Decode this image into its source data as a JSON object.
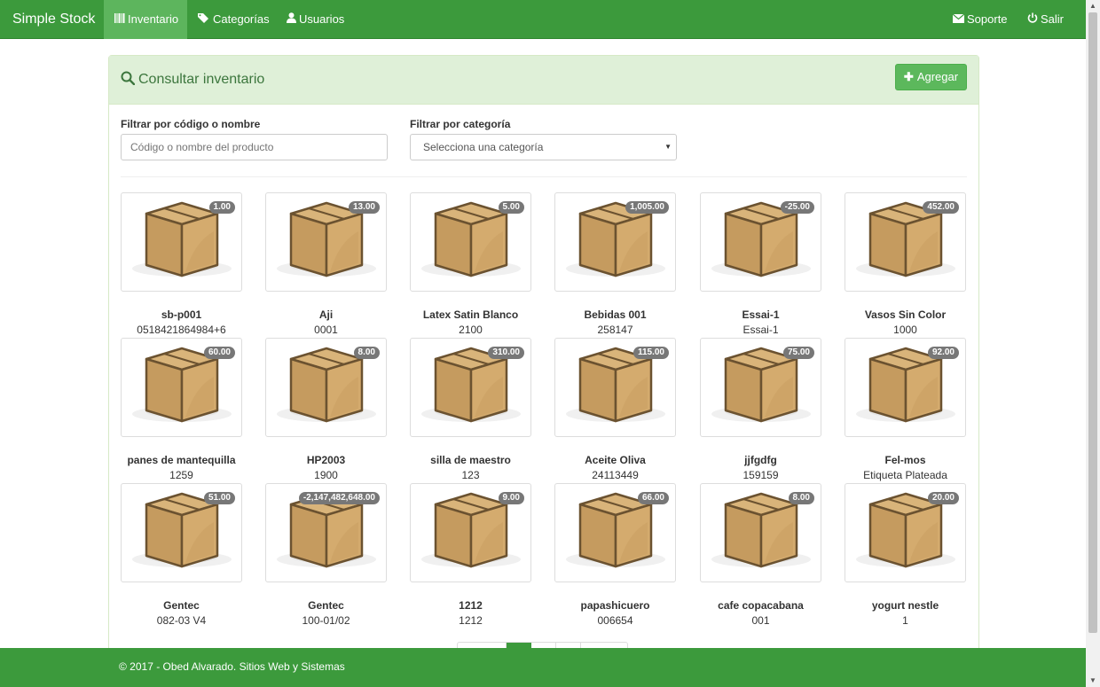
{
  "navbar": {
    "brand": "Simple Stock",
    "items": [
      {
        "label": "Inventario",
        "icon": "barcode-icon"
      },
      {
        "label": "Categorías",
        "icon": "tags-icon"
      },
      {
        "label": "Usuarios",
        "icon": "user-icon"
      }
    ],
    "right_items": [
      {
        "label": "Soporte",
        "icon": "envelope-icon"
      },
      {
        "label": "Salir",
        "icon": "power-icon"
      }
    ]
  },
  "panel": {
    "title": "Consultar inventario",
    "add_button": "Agregar",
    "filter_code_label": "Filtrar por código o nombre",
    "filter_code_placeholder": "Código o nombre del producto",
    "filter_category_label": "Filtrar por categoría",
    "filter_category_selected": "Selecciona una categoría"
  },
  "products": [
    {
      "name": "sb-p001",
      "code": "0518421864984+6",
      "stock": "1.00"
    },
    {
      "name": "Aji",
      "code": "0001",
      "stock": "13.00"
    },
    {
      "name": "Latex Satin Blanco",
      "code": "2100",
      "stock": "5.00"
    },
    {
      "name": "Bebidas 001",
      "code": "258147",
      "stock": "1,005.00"
    },
    {
      "name": "Essai-1",
      "code": "Essai-1",
      "stock": "-25.00"
    },
    {
      "name": "Vasos Sin Color",
      "code": "1000",
      "stock": "452.00"
    },
    {
      "name": "panes de mantequilla",
      "code": "1259",
      "stock": "60.00"
    },
    {
      "name": "HP2003",
      "code": "1900",
      "stock": "8.00"
    },
    {
      "name": "silla de maestro",
      "code": "123",
      "stock": "310.00"
    },
    {
      "name": "Aceite Oliva",
      "code": "24113449",
      "stock": "115.00"
    },
    {
      "name": "jjfgdfg",
      "code": "159159",
      "stock": "75.00"
    },
    {
      "name": "Fel-mos",
      "code": "Etiqueta Plateada",
      "stock": "92.00"
    },
    {
      "name": "Gentec",
      "code": "082-03 V4",
      "stock": "51.00"
    },
    {
      "name": "Gentec",
      "code": "100-01/02",
      "stock": "-2,147,482,648.00"
    },
    {
      "name": "1212",
      "code": "1212",
      "stock": "9.00"
    },
    {
      "name": "papashicuero",
      "code": "006654",
      "stock": "66.00"
    },
    {
      "name": "cafe copacabana",
      "code": "001",
      "stock": "8.00"
    },
    {
      "name": "yogurt nestle",
      "code": "1",
      "stock": "20.00"
    }
  ],
  "footer": {
    "text": "© 2017 - Obed Alvarado. Sitios Web y Sistemas"
  },
  "colors": {
    "navbar": "#3c9a3c",
    "active_nav": "#5db55d",
    "panel_heading": "#dff0d8",
    "panel_title": "#3c763d",
    "add_button": "#5cb85c",
    "badge": "#777777",
    "box": "#c9a268"
  }
}
